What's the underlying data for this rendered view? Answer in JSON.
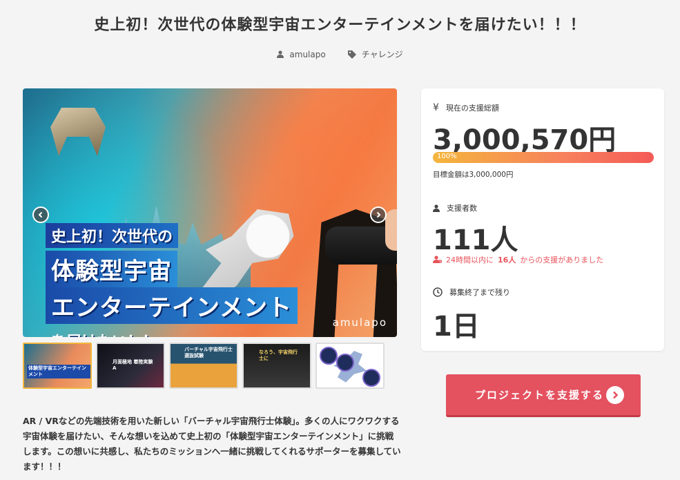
{
  "page": {
    "title": "史上初！次世代の体験型宇宙エンターテインメントを届けたい！！！",
    "author": "amulapo",
    "category": "チャレンジ"
  },
  "hero": {
    "banner_line1": "史上初！次世代の",
    "banner_line2": "体験型宇宙",
    "banner_line3": "エンターテインメント",
    "banner_line4": "を届けたい！！",
    "brand": "amulapo"
  },
  "thumbnails": [
    {
      "label": "体験型宇宙エンターテインメント"
    },
    {
      "label": "月面極地 着陸実験A"
    },
    {
      "label": "バーチャル宇宙飛行士 選抜試験"
    },
    {
      "label": "なろう、宇宙飛行士に"
    },
    {
      "label": ""
    }
  ],
  "description": "AR / VRなどの先端技術を用いた新しい「バーチャル宇宙飛行士体験」。多くの人にワクワクする宇宙体験を届けたい、そんな想いを込めて史上初の「体験型宇宙エンターテインメント」に挑戦します。この想いに共感し、私たちのミッションへ一緒に挑戦してくれるサポーターを募集しています！！！",
  "stats": {
    "total_label": "現在の支援総額",
    "total_value": "3,000,570円",
    "progress_text": "100%",
    "progress_fraction": 1.0,
    "goal_text": "目標金額は3,000,000円",
    "supporters_label": "支援者数",
    "supporters_value": "111人",
    "recent_prefix": "24時間以内に",
    "recent_count": "16人",
    "recent_suffix": "からの支援がありました",
    "remaining_label": "募集終了まで残り",
    "remaining_value": "1日"
  },
  "cta": {
    "label": "プロジェクトを支援する"
  },
  "colors": {
    "accent": "#e4515f",
    "progress_start": "#f4b53c",
    "progress_end": "#f35a55",
    "thumb_active": "#f3b63c"
  },
  "icons": [
    "user-icon",
    "tag-icon",
    "yen-icon",
    "supporters-icon",
    "clock-icon",
    "chevron-left-icon",
    "chevron-right-icon",
    "arrow-right-icon"
  ]
}
